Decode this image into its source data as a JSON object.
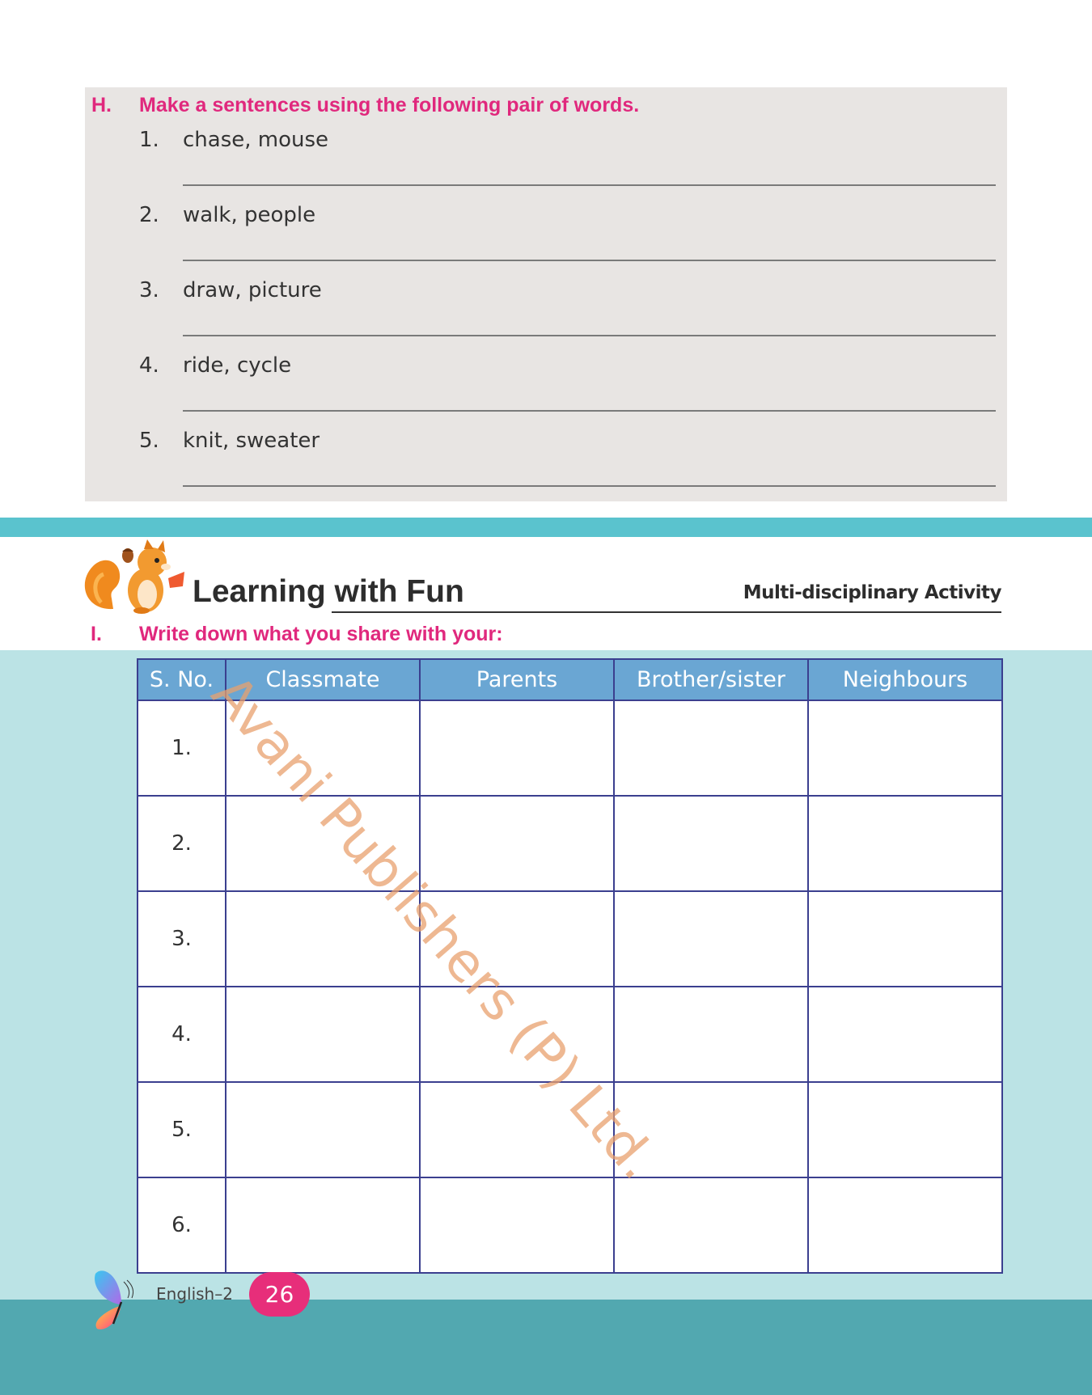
{
  "section_h": {
    "letter": "H.",
    "title": "Make a sentences using the following pair of words.",
    "items": [
      {
        "num": "1.",
        "text": "chase, mouse"
      },
      {
        "num": "2.",
        "text": "walk, people"
      },
      {
        "num": "3.",
        "text": "draw, picture"
      },
      {
        "num": "4.",
        "text": "ride, cycle"
      },
      {
        "num": "5.",
        "text": "knit, sweater"
      }
    ]
  },
  "learning": {
    "title": "Learning with Fun",
    "tag": "Multi-disciplinary Activity"
  },
  "section_i": {
    "letter": "I.",
    "title": "Write down what you share with your:",
    "table": {
      "headers": [
        "S. No.",
        "Classmate",
        "Parents",
        "Brother/sister",
        "Neighbours"
      ],
      "rows": [
        "1.",
        "2.",
        "3.",
        "4.",
        "5.",
        "6."
      ]
    }
  },
  "watermark": "Avani Publishers (P) Ltd.",
  "footer": {
    "subject": "English–2",
    "page": "26"
  },
  "colors": {
    "accent_pink": "#e0287d",
    "header_blue": "#6aa6d3",
    "teal": "#5ac3ce",
    "light_teal": "#bbe3e5"
  }
}
